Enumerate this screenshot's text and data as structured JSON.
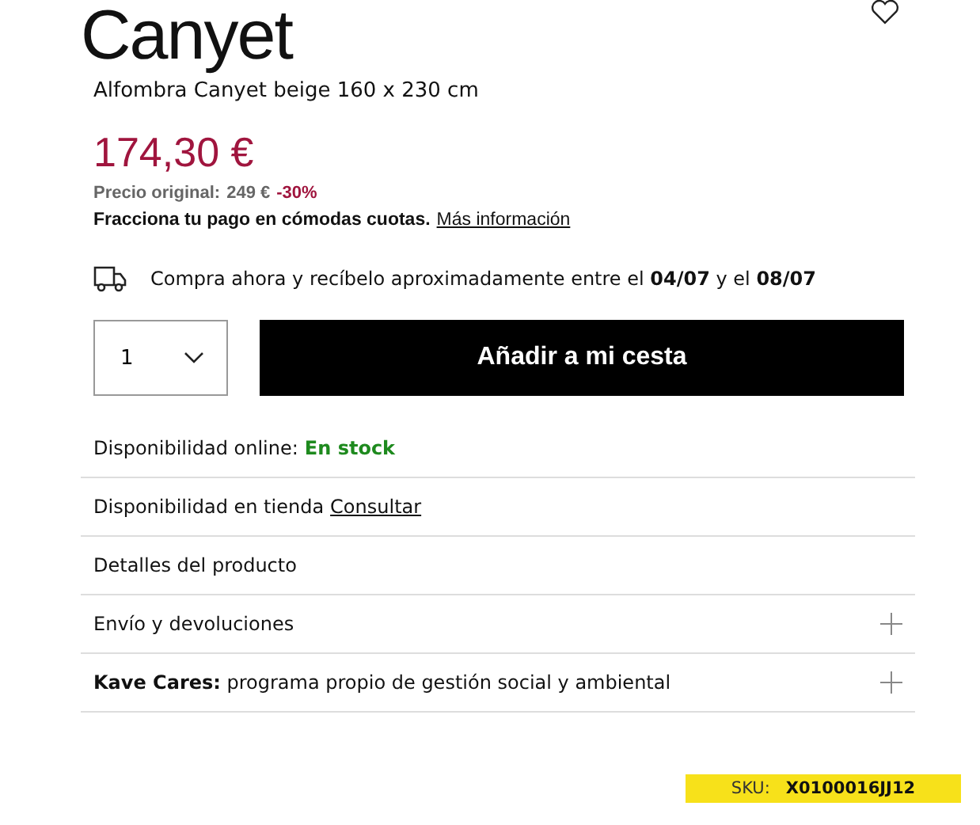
{
  "title": "Canyet",
  "subtitle": "Alfombra Canyet beige 160 x 230 cm",
  "price": "174,30 €",
  "original_price": {
    "label": "Precio original:",
    "value": "249 €",
    "discount": "-30%"
  },
  "installments": {
    "text": "Fracciona tu pago en cómodas cuotas.",
    "link": "Más información"
  },
  "delivery": "Compra ahora y recíbelo aproximadamente entre el **04/07** y el **08/07**",
  "quantity": "1",
  "add_button": "Añadir a mi cesta",
  "rows": [
    {
      "kind": "status",
      "label": "Disponibilidad online:",
      "value": "En stock"
    },
    {
      "kind": "link",
      "label": "Disponibilidad en tienda",
      "link": "Consultar"
    },
    {
      "kind": "plain",
      "label": "Detalles del producto"
    },
    {
      "kind": "expandable",
      "label": "Envío y devoluciones",
      "expanded": false
    },
    {
      "kind": "expandable",
      "label": "**Kave Cares:** programa propio de gestión social y ambiental",
      "expanded": false
    }
  ],
  "sku": {
    "label": "SKU:",
    "value": "X0100016JJ12"
  }
}
